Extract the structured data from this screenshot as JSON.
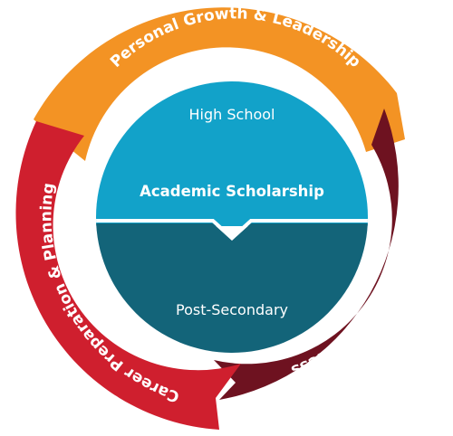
{
  "diagram": {
    "segments": [
      {
        "key": "top",
        "label": "Personal Growth & Leadership",
        "color": "#F39324"
      },
      {
        "key": "right",
        "label": "Mental Health & Wellness",
        "color": "#6E1220"
      },
      {
        "key": "left",
        "label": "Career Preparation & Planning",
        "color": "#CF1F2E"
      }
    ],
    "center": {
      "upper_label": "High School",
      "main_label": "Academic Scholarship",
      "lower_label": "Post-Secondary",
      "upper_color": "#12A2C9",
      "lower_color": "#136479",
      "border_color": "#ffffff"
    }
  }
}
